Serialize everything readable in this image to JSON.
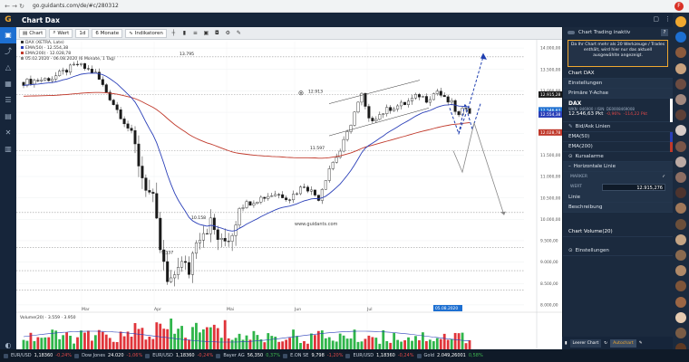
{
  "browser": {
    "url": "go.guidants.com/de/#c/280312",
    "back_label": "←",
    "forward_label": "→",
    "reload_label": "↻",
    "profile_initial": "F"
  },
  "app": {
    "title": "Chart Dax",
    "logo_text": "G",
    "window_controls": [
      "▢",
      "⋮"
    ]
  },
  "left_rail": {
    "icons": [
      "chart-icon",
      "share-icon",
      "alert-icon",
      "portfolio-icon",
      "news-icon",
      "watchlist-icon",
      "tools-icon",
      "info-icon"
    ],
    "bottom_icon": "contrast-icon"
  },
  "toolbar": {
    "chart_label": "Chart",
    "wert_label": "Wert",
    "interval_label": "1d",
    "range_label": "6 Monate",
    "indicators_label": "Indikatoren"
  },
  "legend": {
    "title": "DAX (XETRA, Late)",
    "ema50": "EMA(50) · 12.554,38",
    "ema200": "EMA(200) · 12.028,78",
    "period": "05.02.2020 - 06.08.2020 (6 Monate, 1 Tag)"
  },
  "chart_data": {
    "type": "candlestick",
    "x_tick_labels": [
      "Mar",
      "Apr",
      "Mai",
      "Jun",
      "Jul"
    ],
    "y_tick_labels": [
      "14.000,00",
      "13.500,00",
      "13.000,00",
      "12.500,00",
      "12.000,00",
      "11.500,00",
      "11.000,00",
      "10.500,00",
      "10.000,00",
      "9.500,00",
      "9.000,00",
      "8.500,00",
      "8.000,00"
    ],
    "ylim": [
      7850,
      14150
    ],
    "annotations": [
      {
        "text": "13.795",
        "x": "Feb",
        "y": 13795
      },
      {
        "text": "12.913",
        "x": "Jun",
        "y": 12913
      },
      {
        "text": "11.597",
        "x": "Jun",
        "y": 11597
      },
      {
        "text": "10.158",
        "x": "Apr-Mai",
        "y": 10158
      },
      {
        "text": "9.337",
        "x": "Apr",
        "y": 9337
      }
    ],
    "price_labels": [
      {
        "text": "12.915,28",
        "y": 12915.28
      },
      {
        "text": "12.546,63",
        "y": 12546.63
      },
      {
        "text": "12.554,38",
        "y": 12554.38
      },
      {
        "text": "12.028,78",
        "y": 12028.78
      }
    ],
    "date_label": "05.08.2020",
    "watermark": "www.guidants.com",
    "volume_label": "Volume(20) · 3.559 · 3.950",
    "horizontal_levels": [
      13795,
      12913,
      11597,
      10158,
      9337
    ]
  },
  "right_panel": {
    "toggle_label": "Chart Trading inaktiv",
    "help_label": "?",
    "notice": "Da Ihr Chart mehr als 20 Werkzeuge / Trades enthält, wird hier nur das aktuell ausgewählte angezeigt.",
    "section_chart": "Chart DAX",
    "einstellungen": "Einstellungen",
    "primaere_achse": "Primäre Y-Achse",
    "dax": {
      "name": "DAX",
      "wkn": "WKN: 846900 / ISIN: DE0008469008",
      "price": "12.546,63 Pkt",
      "change_pct": "-0,96%",
      "change_abs": "-114,22 Pkt"
    },
    "bid_ask": "Bid/Ask Linien",
    "ema50": "EMA(50)",
    "ema200": "EMA(200)",
    "kursalarme": "Kursalarme",
    "horizontale_linie": "Horizontale Linie",
    "marker": "MARKER",
    "wert": "WERT",
    "wert_value": "12.915,276",
    "linie": "Linie",
    "beschreibung": "Beschreibung",
    "chart_volume": "Chart Volume(20)",
    "einstellungen2": "Einstellungen"
  },
  "rp_bottom": {
    "leerer_chart": "Leerer Chart",
    "autochart": "Autochart"
  },
  "ticker": [
    {
      "name": "EUR/USD",
      "value": "1,18360",
      "change": "-0,24%",
      "dir": "neg"
    },
    {
      "name": "Dow Jones",
      "value": "24.020",
      "change": "-1,06%",
      "dir": "neg"
    },
    {
      "name": "EUR/USD",
      "value": "1,18360",
      "change": "-0,24%",
      "dir": "neg"
    },
    {
      "name": "Bayer AG",
      "value": "56,350",
      "change": "0,37%",
      "dir": "pos"
    },
    {
      "name": "E.ON SE",
      "value": "9,798",
      "change": "-1,20%",
      "dir": "neg"
    },
    {
      "name": "EUR/USD",
      "value": "1,18360",
      "change": "-0,24%",
      "dir": "neg"
    },
    {
      "name": "Gold",
      "value": "2.049,26001",
      "change": "0,58%",
      "dir": "pos"
    }
  ],
  "colors": {
    "ema50": "#2a3fb8",
    "ema200": "#c0392b",
    "accent": "#1d6fd1",
    "header": "#16253a"
  }
}
